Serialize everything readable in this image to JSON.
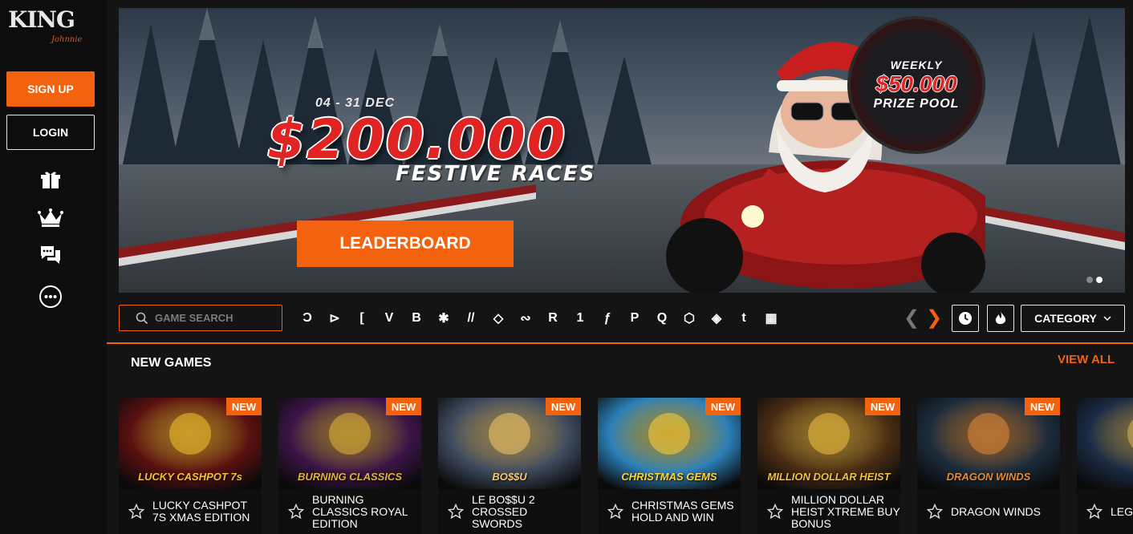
{
  "sidebar": {
    "logo_main": "KING",
    "logo_sub": "Johnnie",
    "signup_label": "SIGN UP",
    "login_label": "LOGIN",
    "icons": [
      "gift-icon",
      "crown-icon",
      "chat-icon",
      "more-icon"
    ]
  },
  "banner": {
    "date": "04 - 31 DEC",
    "amount": "$200.000",
    "subtitle": "FESTIVE RACES",
    "cta_label": "LEADERBOARD",
    "prize_weekly": "WEEKLY",
    "prize_amount": "$50.000",
    "prize_pool": "PRIZE POOL",
    "slides": 2,
    "active_slide": 2
  },
  "toolbar": {
    "search_placeholder": "GAME SEARCH",
    "providers": [
      "Ɔ",
      "⊳",
      "[",
      "V",
      "B",
      "✱",
      "//",
      "◇",
      "∾",
      "R",
      "1",
      "ƒ",
      "P",
      "Q",
      "⬡",
      "◈",
      "t",
      "▦"
    ],
    "category_label": "CATEGORY"
  },
  "section": {
    "title": "NEW GAMES",
    "view_all": "VIEW ALL"
  },
  "games": [
    {
      "name": "LUCKY CASHPOT 7S XMAS EDITION",
      "art_text": "LUCKY CASHPOT 7s",
      "badge": "NEW",
      "bg": "#5a1010",
      "accent": "#f5c12e"
    },
    {
      "name": "BURNING CLASSICS ROYAL EDITION",
      "art_text": "BURNING CLASSICS",
      "badge": "NEW",
      "bg": "#3b1447",
      "accent": "#e0b23a"
    },
    {
      "name": "LE BO$$U 2 CROSSED SWORDS",
      "art_text": "BO$$U",
      "badge": "NEW",
      "bg": "#3d4a5e",
      "accent": "#f2c86a"
    },
    {
      "name": "CHRISTMAS GEMS HOLD AND WIN",
      "art_text": "CHRISTMAS GEMS",
      "badge": "NEW",
      "bg": "#2b7fb8",
      "accent": "#ffd23a"
    },
    {
      "name": "MILLION DOLLAR HEIST XTREME BUY BONUS",
      "art_text": "MILLION DOLLAR HEIST",
      "badge": "NEW",
      "bg": "#4a2d14",
      "accent": "#f0c040"
    },
    {
      "name": "DRAGON WINDS",
      "art_text": "DRAGON WINDS",
      "badge": "NEW",
      "bg": "#1c2c3c",
      "accent": "#e08a3a"
    },
    {
      "name": "LEG AN",
      "art_text": "LEGA",
      "badge": "",
      "bg": "#1a2b44",
      "accent": "#d8b45a"
    }
  ]
}
